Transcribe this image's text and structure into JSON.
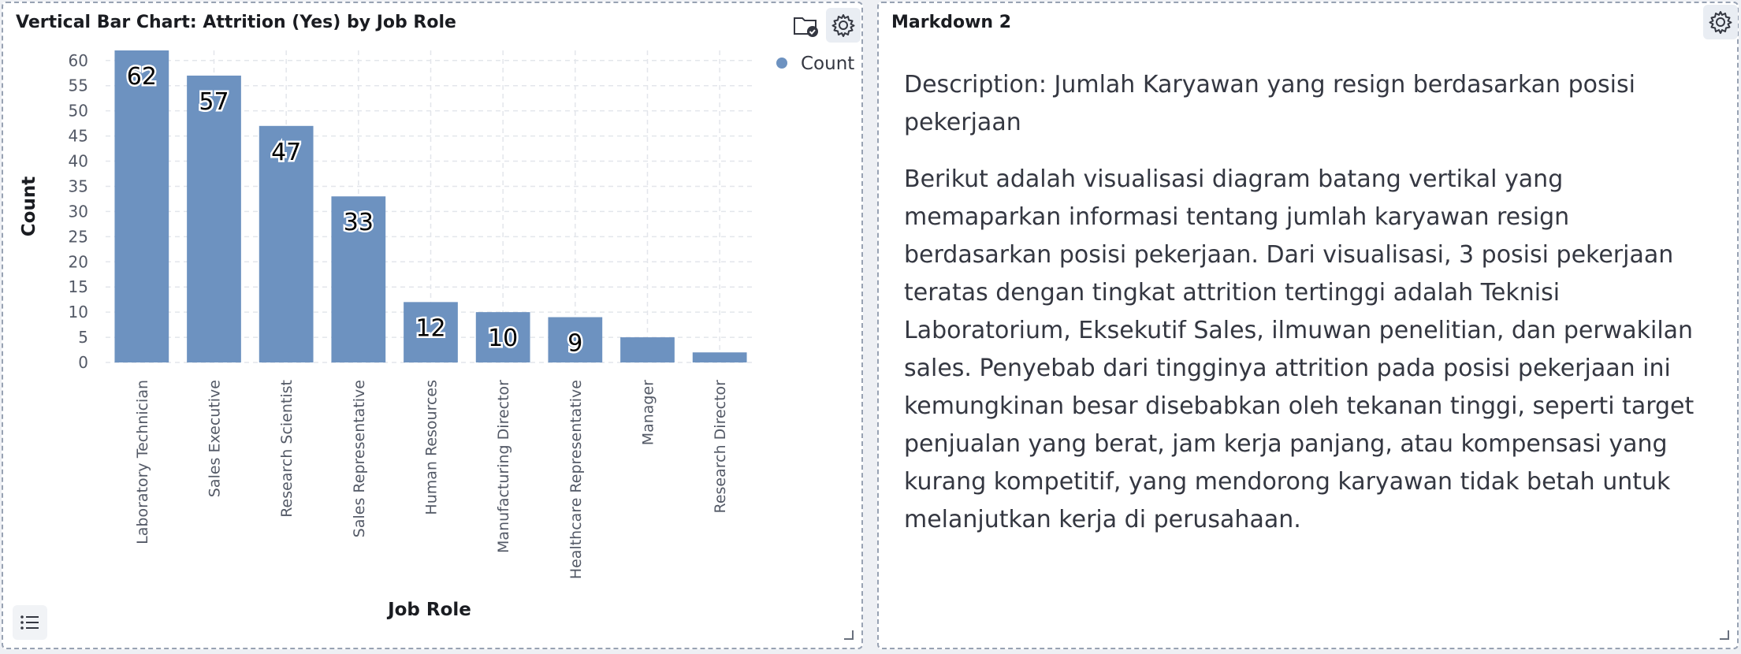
{
  "left_panel": {
    "title": "Vertical Bar Chart: Attrition (Yes) by Job Role",
    "icons": [
      "folder-check-icon",
      "gear-icon",
      "legend-list-icon"
    ]
  },
  "right_panel": {
    "title": "Markdown 2",
    "paragraphs": [
      "Description: Jumlah Karyawan yang resign berdasarkan posisi pekerjaan",
      "Berikut adalah visualisasi diagram batang vertikal yang memaparkan informasi tentang jumlah karyawan resign berdasarkan posisi pekerjaan. Dari visualisasi, 3 posisi pekerjaan teratas dengan tingkat attrition tertinggi adalah Teknisi Laboratorium, Eksekutif Sales, ilmuwan penelitian, dan perwakilan sales. Penyebab dari tingginya attrition pada posisi pekerjaan ini kemungkinan besar disebabkan oleh tekanan tinggi, seperti target penjualan yang berat, jam kerja panjang, atau kompensasi yang kurang kompetitif, yang mendorong karyawan tidak betah untuk melanjutkan kerja di perusahaan."
    ],
    "icons": [
      "gear-icon"
    ]
  },
  "colors": {
    "bar": "#6d92c0",
    "grid": "#e3e6eb",
    "axis_text": "#535966",
    "panel_border": "#98a2b3"
  },
  "chart_data": {
    "type": "bar",
    "categories": [
      "Laboratory Technician",
      "Sales Executive",
      "Research Scientist",
      "Sales Representative",
      "Human Resources",
      "Manufacturing Director",
      "Healthcare Representative",
      "Manager",
      "Research Director"
    ],
    "series": [
      {
        "name": "Count",
        "values": [
          62,
          57,
          47,
          33,
          12,
          10,
          9,
          5,
          2
        ]
      }
    ],
    "data_labels": [
      "62",
      "57",
      "47",
      "33",
      "12",
      "10",
      "9",
      "",
      ""
    ],
    "xlabel": "Job Role",
    "ylabel": "Count",
    "ylim": [
      0,
      62
    ],
    "yticks": [
      0,
      5,
      10,
      15,
      20,
      25,
      30,
      35,
      40,
      45,
      50,
      55,
      60
    ],
    "grid": true,
    "legend": {
      "position": "top-right",
      "entries": [
        "Count"
      ]
    }
  }
}
